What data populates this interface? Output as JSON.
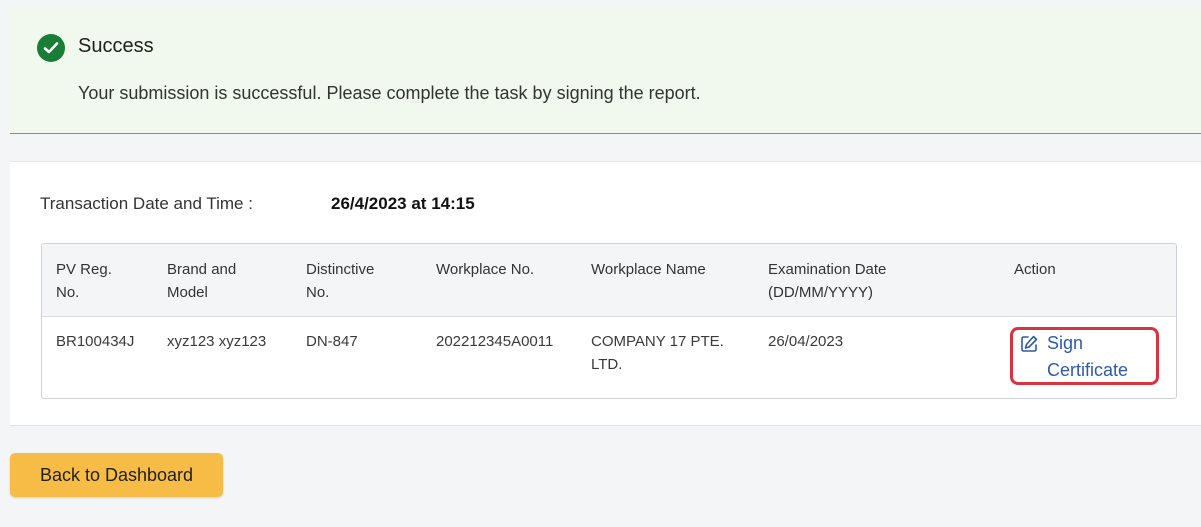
{
  "success": {
    "icon": "check-circle-icon",
    "title": "Success",
    "message": "Your submission is successful. Please complete the task by signing the report."
  },
  "transaction": {
    "label": "Transaction Date and Time :",
    "value": "26/4/2023 at 14:15"
  },
  "table": {
    "headers": [
      "PV Reg.\nNo.",
      "Brand and\nModel",
      "Distinctive\nNo.",
      "Workplace No.",
      "Workplace Name",
      "Examination Date\n(DD/MM/YYYY)",
      "Action"
    ],
    "rows": [
      {
        "pv_reg_no": "BR100434J",
        "brand_model": "xyz123 xyz123",
        "distinctive_no": "DN-847",
        "workplace_no": "202212345A0011",
        "workplace_name": "COMPANY 17 PTE.\nLTD.",
        "examination_date": "26/04/2023",
        "action_label": "Sign\nCertificate",
        "action_icon": "edit-icon"
      }
    ]
  },
  "footer": {
    "back_label": "Back to Dashboard"
  },
  "colors": {
    "success_green": "#1a7d35",
    "banner_bg": "#f1f8ee",
    "link_blue": "#2f5aa8",
    "highlight_red": "#d93240",
    "button_yellow": "#f7bc46"
  }
}
